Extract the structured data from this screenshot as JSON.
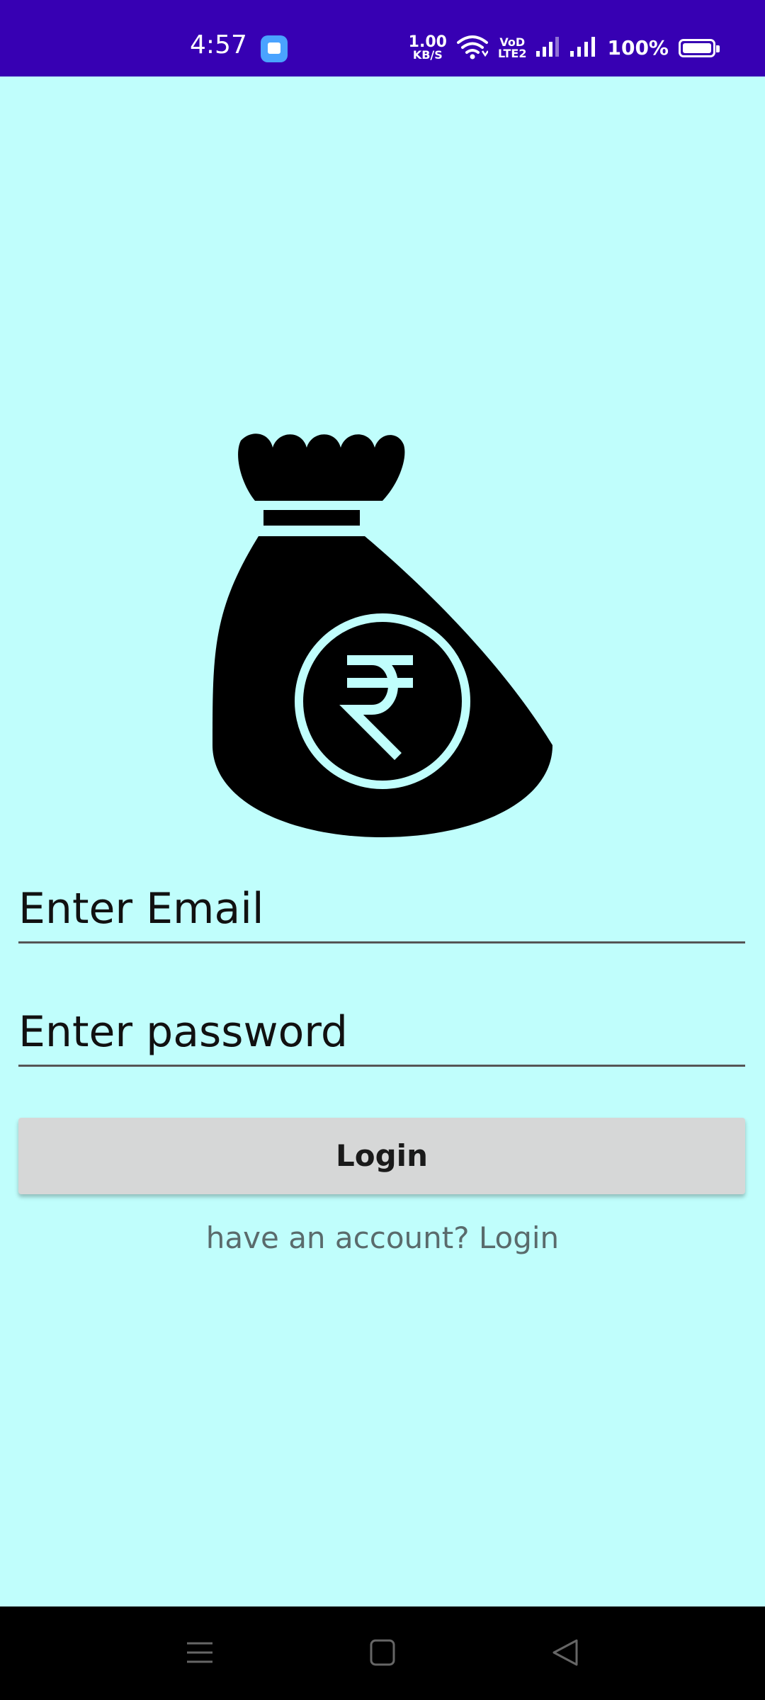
{
  "status_bar": {
    "time": "4:57",
    "net_speed_value": "1.00",
    "net_speed_unit": "KB/S",
    "volte_top": "VoD",
    "volte_bottom": "LTE2",
    "battery_percent": "100%"
  },
  "login_form": {
    "email_placeholder": "Enter Email",
    "password_placeholder": "Enter password",
    "login_button_label": "Login",
    "account_prompt": "have an account? Login"
  },
  "icons": {
    "logo": "money-bag-rupee-icon",
    "nav_menu": "menu-icon",
    "nav_home": "home-square-icon",
    "nav_back": "back-triangle-icon"
  },
  "colors": {
    "background": "#c0fefc",
    "status_bar": "#3700b3",
    "button": "#d6d7d7",
    "nav_bar": "#000000"
  }
}
